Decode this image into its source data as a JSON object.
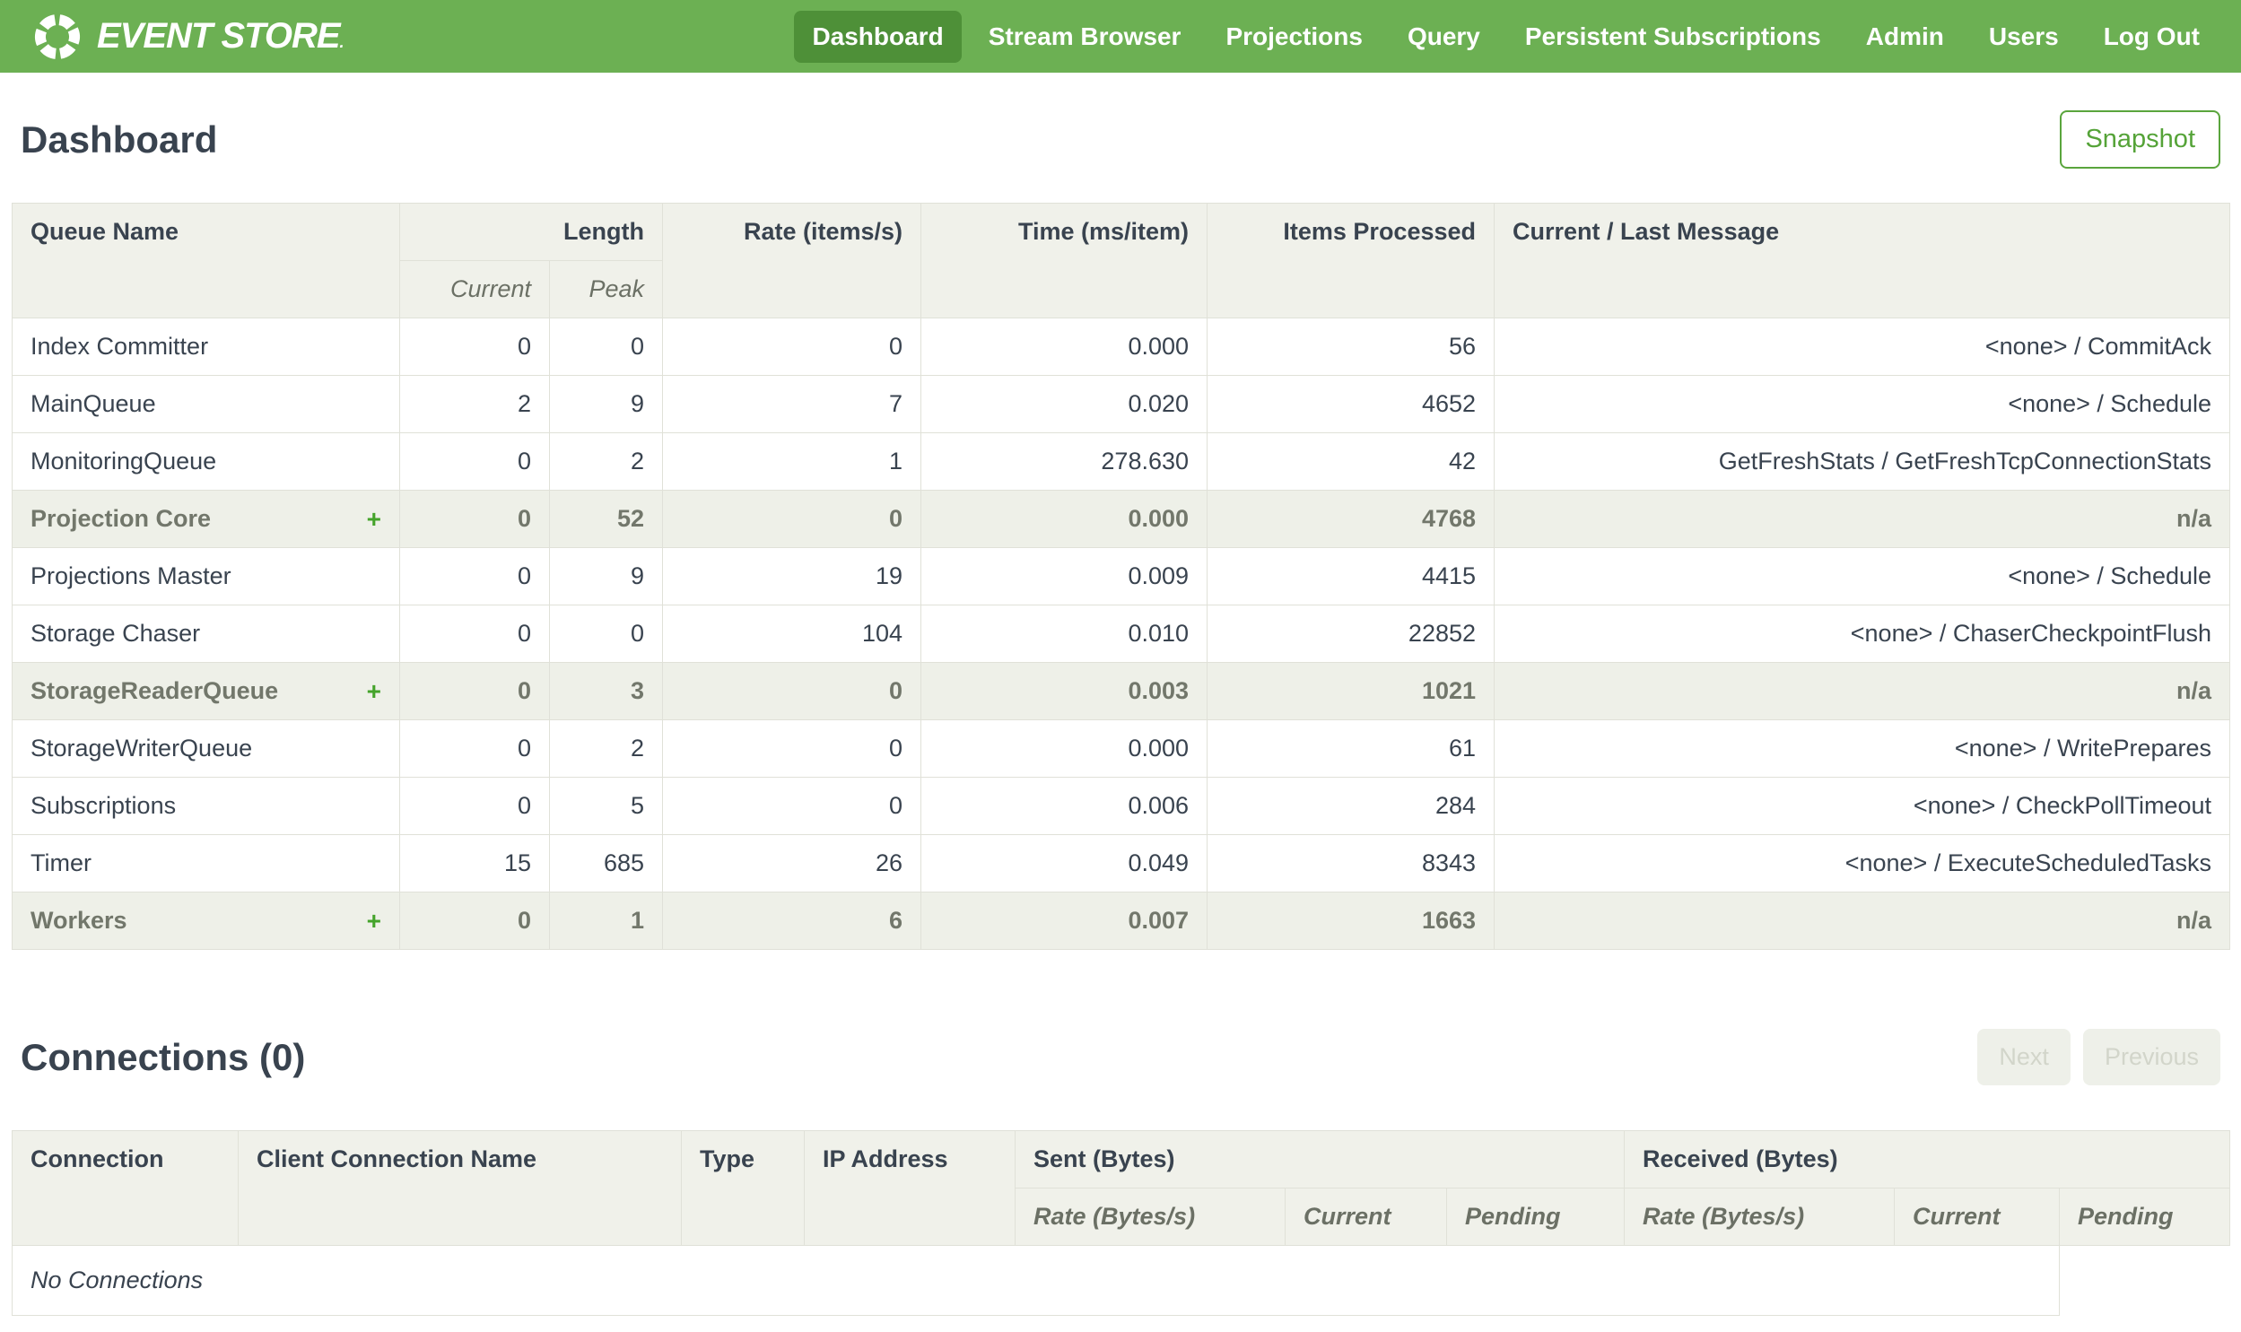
{
  "brand": {
    "name": "EVENT STORE",
    "tm": "."
  },
  "nav": {
    "items": [
      {
        "label": "Dashboard",
        "active": true
      },
      {
        "label": "Stream Browser",
        "active": false
      },
      {
        "label": "Projections",
        "active": false
      },
      {
        "label": "Query",
        "active": false
      },
      {
        "label": "Persistent Subscriptions",
        "active": false
      },
      {
        "label": "Admin",
        "active": false
      },
      {
        "label": "Users",
        "active": false
      },
      {
        "label": "Log Out",
        "active": false
      }
    ]
  },
  "page": {
    "title": "Dashboard",
    "snapshot_label": "Snapshot"
  },
  "queues_table": {
    "headers": {
      "queue_name": "Queue Name",
      "length": "Length",
      "current": "Current",
      "peak": "Peak",
      "rate": "Rate (items/s)",
      "time": "Time (ms/item)",
      "items_processed": "Items Processed",
      "message": "Current / Last Message"
    },
    "expand_symbol": "+",
    "rows": [
      {
        "name": "Index Committer",
        "current": "0",
        "peak": "0",
        "rate": "0",
        "time": "0.000",
        "items": "56",
        "message": "<none> / CommitAck"
      },
      {
        "name": "MainQueue",
        "current": "2",
        "peak": "9",
        "rate": "7",
        "time": "0.020",
        "items": "4652",
        "message": "<none> / Schedule"
      },
      {
        "name": "MonitoringQueue",
        "current": "0",
        "peak": "2",
        "rate": "1",
        "time": "278.630",
        "items": "42",
        "message": "GetFreshStats / GetFreshTcpConnectionStats"
      },
      {
        "name": "Projection Core",
        "current": "0",
        "peak": "52",
        "rate": "0",
        "time": "0.000",
        "items": "4768",
        "message": "n/a"
      },
      {
        "name": "Projections Master",
        "current": "0",
        "peak": "9",
        "rate": "19",
        "time": "0.009",
        "items": "4415",
        "message": "<none> / Schedule"
      },
      {
        "name": "Storage Chaser",
        "current": "0",
        "peak": "0",
        "rate": "104",
        "time": "0.010",
        "items": "22852",
        "message": "<none> / ChaserCheckpointFlush"
      },
      {
        "name": "StorageReaderQueue",
        "current": "0",
        "peak": "3",
        "rate": "0",
        "time": "0.003",
        "items": "1021",
        "message": "n/a"
      },
      {
        "name": "StorageWriterQueue",
        "current": "0",
        "peak": "2",
        "rate": "0",
        "time": "0.000",
        "items": "61",
        "message": "<none> / WritePrepares"
      },
      {
        "name": "Subscriptions",
        "current": "0",
        "peak": "5",
        "rate": "0",
        "time": "0.006",
        "items": "284",
        "message": "<none> / CheckPollTimeout"
      },
      {
        "name": "Timer",
        "current": "15",
        "peak": "685",
        "rate": "26",
        "time": "0.049",
        "items": "8343",
        "message": "<none> / ExecuteScheduledTasks"
      },
      {
        "name": "Workers",
        "current": "0",
        "peak": "1",
        "rate": "6",
        "time": "0.007",
        "items": "1663",
        "message": "n/a"
      }
    ]
  },
  "connections": {
    "title": "Connections (0)",
    "next_label": "Next",
    "previous_label": "Previous",
    "headers": {
      "connection": "Connection",
      "client_name": "Client Connection Name",
      "type": "Type",
      "ip": "IP Address",
      "sent": "Sent (Bytes)",
      "received": "Received (Bytes)",
      "rate": "Rate (Bytes/s)",
      "current": "Current",
      "pending": "Pending"
    },
    "empty_text": "No Connections"
  },
  "colors": {
    "nav_green": "#6cb053",
    "active_green": "#4e9038",
    "accent_green": "#55a338",
    "header_bg": "#f0f1ea",
    "group_row_bg": "#eef0e8",
    "text_dark": "#39434f"
  }
}
